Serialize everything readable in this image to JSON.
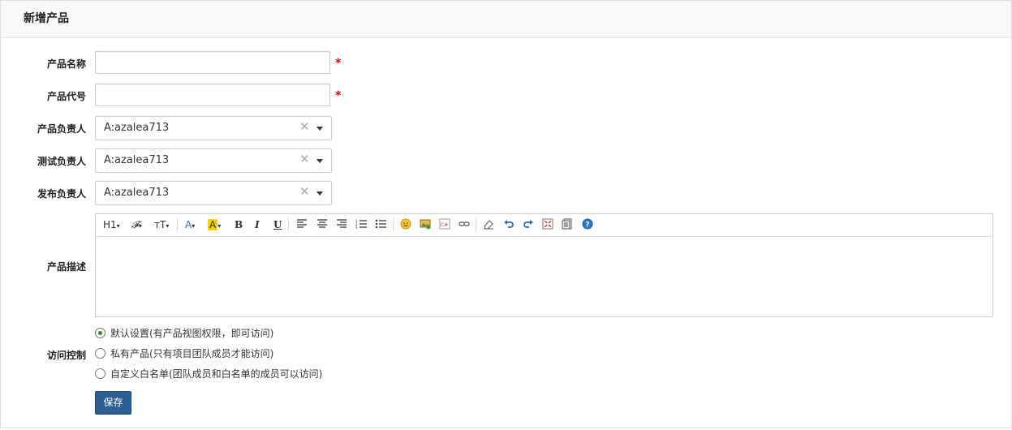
{
  "page": {
    "title": "新增产品"
  },
  "form": {
    "product_name": {
      "label": "产品名称",
      "value": "",
      "required_mark": "*"
    },
    "product_code": {
      "label": "产品代号",
      "value": "",
      "required_mark": "*"
    },
    "product_owner": {
      "label": "产品负责人",
      "value": "A:azalea713"
    },
    "qa_owner": {
      "label": "测试负责人",
      "value": "A:azalea713"
    },
    "release_owner": {
      "label": "发布负责人",
      "value": "A:azalea713"
    },
    "description": {
      "label": "产品描述",
      "toolbar": {
        "heading": "H1",
        "font": "𝓕",
        "size": "ᴛT",
        "font_color": "A",
        "bg_color": "A",
        "bold": "B",
        "italic": "I",
        "underline": "U"
      }
    },
    "access": {
      "label": "访问控制",
      "options": [
        {
          "label": "默认设置(有产品视图权限，即可访问)",
          "selected": true
        },
        {
          "label": "私有产品(只有项目团队成员才能访问)",
          "selected": false
        },
        {
          "label": "自定义白名单(团队成员和白名单的成员可以访问)",
          "selected": false
        }
      ]
    },
    "save_label": "保存"
  },
  "icons": [
    "clear-icon",
    "dropdown-caret-icon",
    "emoji-icon",
    "image-icon",
    "code-icon",
    "link-icon",
    "eraser-icon",
    "undo-icon",
    "redo-icon",
    "fullscreen-icon",
    "source-icon",
    "help-icon"
  ],
  "colors": {
    "required": "#dd0000",
    "save_button": "#2b5f95",
    "radio_selected": "#2a8a2a"
  }
}
